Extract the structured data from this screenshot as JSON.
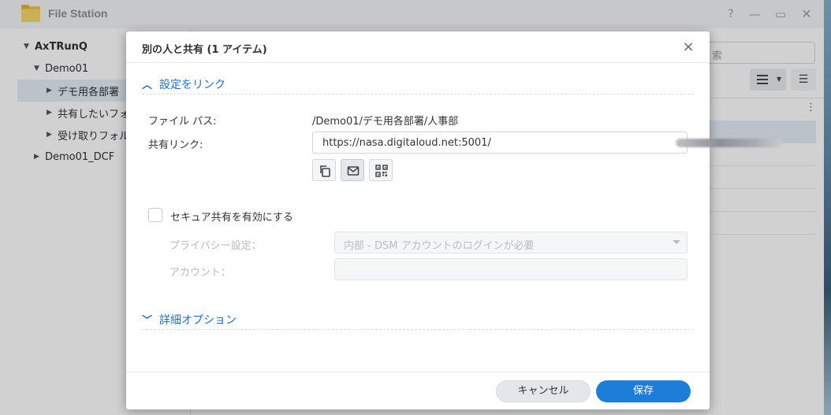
{
  "app": {
    "title": "File Station",
    "controls": {
      "help": "?",
      "minimize": "—",
      "maximize": "▭",
      "close": "✕"
    }
  },
  "tree": {
    "root": "AxTRunQ",
    "items": [
      {
        "label": "Demo01"
      },
      {
        "label": "デモ用各部署"
      },
      {
        "label": "共有したいフォ"
      },
      {
        "label": "受け取りフォル"
      },
      {
        "label": "Demo01_DCF"
      }
    ]
  },
  "main": {
    "search_placeholder": "索",
    "more": "⋮"
  },
  "dialog": {
    "title": "別の人と共有 (1 アイテム)",
    "close": "×",
    "link_section": "設定をリンク",
    "file_path_label": "ファイル パス:",
    "file_path_value": "/Demo01/デモ用各部署/人事部",
    "share_link_label": "共有リンク:",
    "share_link_value": "https://nasa.digitaloud.net:5001/",
    "actions": [
      "copy-icon",
      "mail-icon",
      "qr-code-icon"
    ],
    "secure_share": {
      "label": "セキュア共有を有効にする",
      "checked": false
    },
    "privacy_label": "プライバシー設定：",
    "privacy_value": "内部 - DSM アカウントのログインが必要",
    "account_label": "アカウント：",
    "account_value": "",
    "advanced_section": "詳細オプション",
    "cancel": "キャンセル",
    "save": "保存"
  },
  "colors": {
    "accent": "#1c7ed8",
    "link_blue": "#1d72c5",
    "selection": "#e4edf7"
  }
}
